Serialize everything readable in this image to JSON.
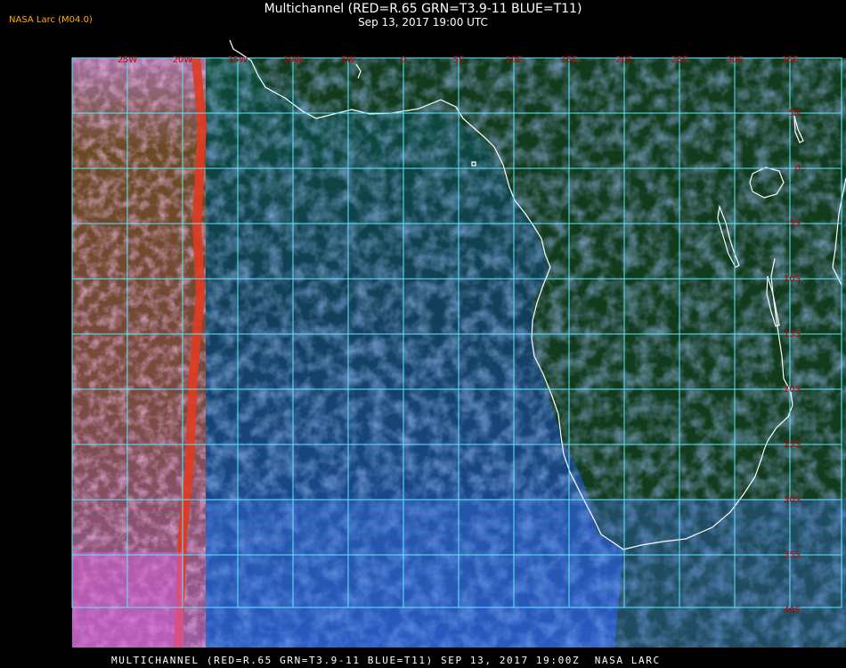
{
  "header": {
    "brand": "NASA Larc (M04.0)",
    "title": "Multichannel (RED=R.65 GRN=T3.9-11 BLUE=T11)",
    "subtitle": "Sep 13, 2017 19:00 UTC"
  },
  "footer": {
    "caption": "MULTICHANNEL (RED=R.65 GRN=T3.9-11 BLUE=T11) SEP 13, 2017 19:00Z  NASA LARC"
  },
  "colors": {
    "grid": "#5fe8ff",
    "label": "#c00000",
    "coast": "#ffffff",
    "ocean": "#0a3a3a",
    "cloud_blue": "#3a78e8",
    "cloud_pink": "#e070e0",
    "land_brown": "#5a3a1c"
  },
  "map": {
    "lon_labels": [
      "25W",
      "20W",
      "15W",
      "10W",
      "5W",
      "0",
      "5E",
      "10E",
      "15E",
      "20E",
      "25E",
      "30E",
      "35E"
    ],
    "lat_labels": [
      "5N",
      "0",
      "5S",
      "10S",
      "15S",
      "20S",
      "25S",
      "30S",
      "35S",
      "40S"
    ]
  }
}
